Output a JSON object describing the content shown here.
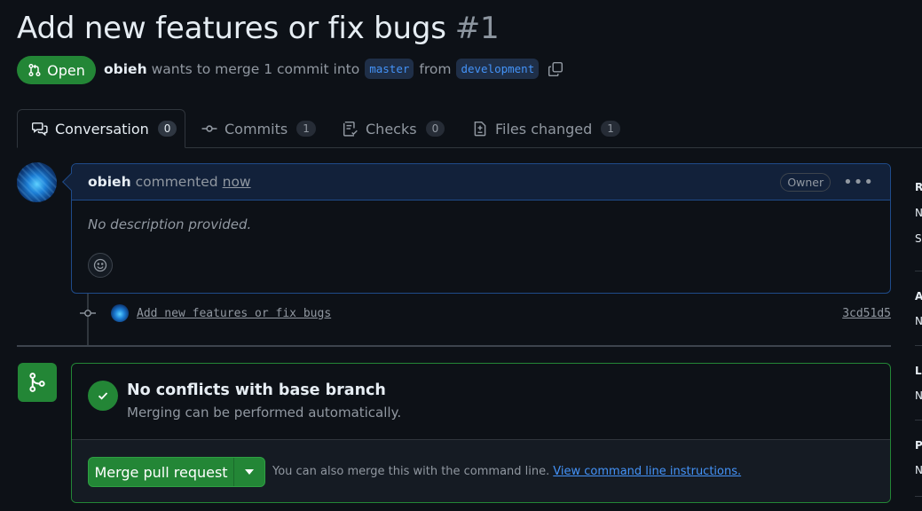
{
  "pr": {
    "title": "Add new features or fix bugs",
    "number": "#1",
    "state": "Open",
    "author": "obieh",
    "merge_text": "wants to merge 1 commit into",
    "base_branch": "master",
    "from_text": "from",
    "head_branch": "development"
  },
  "tabs": [
    {
      "label": "Conversation",
      "count": "0",
      "icon": "conversation-icon"
    },
    {
      "label": "Commits",
      "count": "1",
      "icon": "commit-icon"
    },
    {
      "label": "Checks",
      "count": "0",
      "icon": "checklist-icon"
    },
    {
      "label": "Files changed",
      "count": "1",
      "icon": "file-diff-icon"
    }
  ],
  "comment": {
    "author": "obieh",
    "action": "commented",
    "time": "now",
    "role": "Owner",
    "body": "No description provided."
  },
  "commit": {
    "message": "Add new features or fix bugs",
    "sha": "3cd51d5"
  },
  "merge": {
    "title": "No conflicts with base branch",
    "subtitle": "Merging can be performed automatically.",
    "button": "Merge pull request",
    "hint": "You can also merge this with the command line.",
    "hint_link": "View command line instructions."
  },
  "sidebar": {
    "letters": [
      "R",
      "N",
      "S",
      "A",
      "N",
      "L",
      "N",
      "P",
      "N"
    ]
  },
  "colors": {
    "background": "#0d1117",
    "accent_green": "#238636",
    "link_blue": "#4493f8",
    "muted": "#9198a1"
  }
}
